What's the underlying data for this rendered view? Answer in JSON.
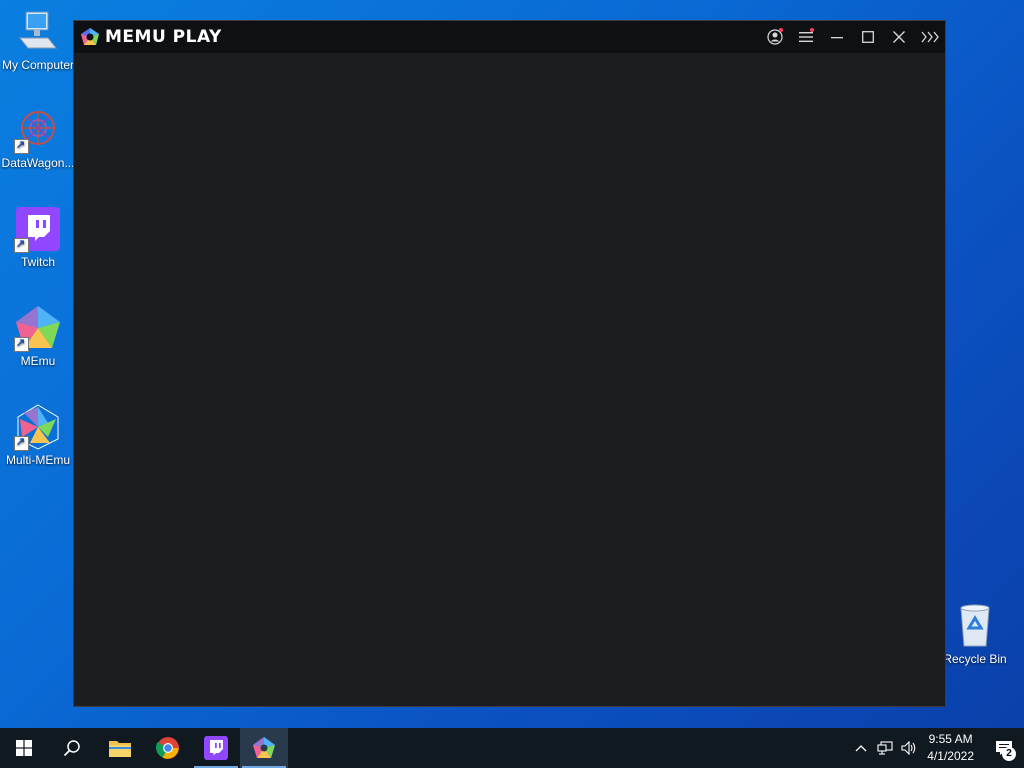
{
  "desktop": {
    "icons": [
      {
        "label": "My Computer",
        "icon": "computer-icon"
      },
      {
        "label": "DataWagon...",
        "icon": "datawagon-icon"
      },
      {
        "label": "Twitch",
        "icon": "twitch-icon"
      },
      {
        "label": "MEmu",
        "icon": "memu-icon"
      },
      {
        "label": "Multi-MEmu",
        "icon": "multi-memu-icon"
      },
      {
        "label": "Recycle Bin",
        "icon": "recycle-bin-icon"
      }
    ]
  },
  "memu_window": {
    "title": "MEMU PLAY",
    "controls": [
      "account-icon",
      "menu-icon",
      "minimize-icon",
      "maximize-icon",
      "close-icon",
      "sidebar-expand-icon"
    ],
    "accent": "#ff3b5c"
  },
  "taskbar": {
    "apps": [
      "start-icon",
      "search-icon",
      "file-explorer-icon",
      "chrome-icon",
      "twitch-icon",
      "memu-icon"
    ],
    "clock": {
      "time": "9:55 AM",
      "date": "4/1/2022"
    },
    "notifications": "2"
  }
}
